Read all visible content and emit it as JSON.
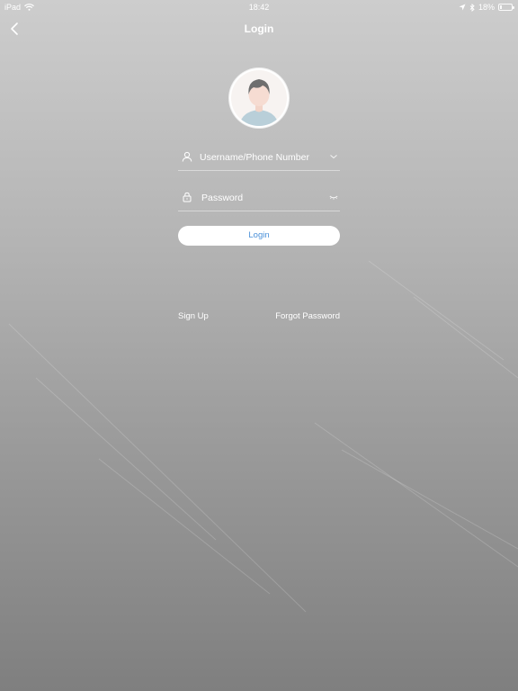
{
  "status_bar": {
    "device": "iPad",
    "time": "18:42",
    "battery_text": "18%",
    "battery_level": 0.18,
    "icons": [
      "wifi-icon",
      "location-arrow-icon",
      "bluetooth-icon",
      "battery-icon"
    ]
  },
  "nav": {
    "title": "Login",
    "back_icon": "chevron-left-icon"
  },
  "avatar": {
    "icon": "default-user-avatar-icon"
  },
  "form": {
    "username": {
      "placeholder": "Username/Phone Number",
      "value": "",
      "icon": "user-icon",
      "trailing_icon": "chevron-down-icon"
    },
    "password": {
      "placeholder": "Password",
      "value": "",
      "icon": "lock-icon",
      "trailing_icon": "eye-closed-icon"
    },
    "login_label": "Login"
  },
  "links": {
    "signup": "Sign Up",
    "forgot": "Forgot Password"
  },
  "colors": {
    "accent": "#4a90d9",
    "background_top": "#cdcdcd",
    "background_bottom": "#7f7f7f"
  }
}
